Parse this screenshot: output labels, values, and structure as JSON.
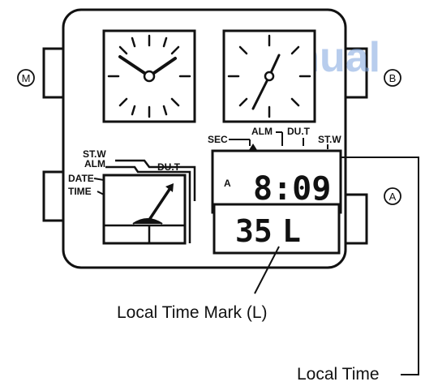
{
  "watermark": "Manual",
  "buttons": {
    "m": "M",
    "b": "B",
    "a": "A"
  },
  "mode_labels": {
    "sec": "SEC",
    "alm": "ALM",
    "dut": "DU.T",
    "stw": "ST.W"
  },
  "dial_labels": {
    "stw": "ST.W",
    "alm": "ALM",
    "date": "DATE",
    "time": "TIME",
    "dut": "DU.T"
  },
  "upper_display": {
    "indicator": "A",
    "time": "8:09"
  },
  "lower_display": {
    "value": "35",
    "mark": "L"
  },
  "callouts": {
    "local_time_mark": "Local Time Mark (L)",
    "local_time": "Local Time"
  }
}
